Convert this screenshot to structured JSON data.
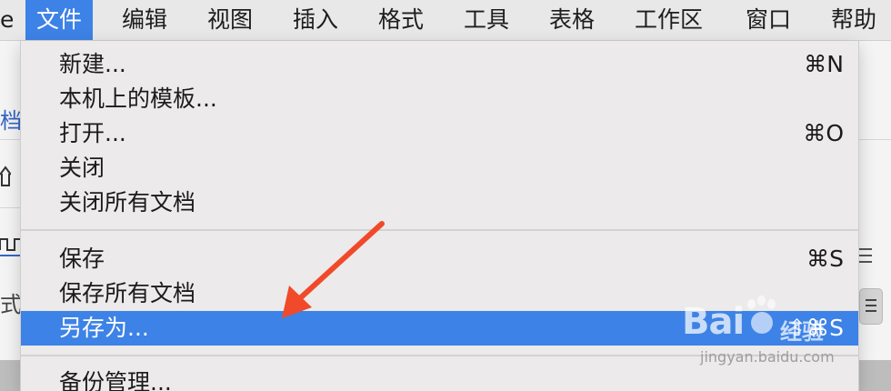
{
  "menubar": {
    "partial_left": "e",
    "items": [
      {
        "label": "文件",
        "active": true
      },
      {
        "label": "编辑"
      },
      {
        "label": "视图"
      },
      {
        "label": "插入"
      },
      {
        "label": "格式"
      },
      {
        "label": "工具"
      },
      {
        "label": "表格"
      },
      {
        "label": "工作区"
      },
      {
        "label": "窗口"
      },
      {
        "label": "帮助"
      }
    ]
  },
  "background": {
    "left_link": "档",
    "left_partial_text": "式",
    "left_home_icon": "home-icon",
    "left_ruler_icon": "ruler-icon"
  },
  "file_menu": {
    "items": [
      {
        "label": "新建...",
        "shortcut": "⌘N"
      },
      {
        "label": "本机上的模板...",
        "shortcut": ""
      },
      {
        "label": "打开...",
        "shortcut": "⌘O"
      },
      {
        "label": "关闭",
        "shortcut": ""
      },
      {
        "label": "关闭所有文档",
        "shortcut": ""
      },
      {
        "label": "保存",
        "shortcut": "⌘S"
      },
      {
        "label": "保存所有文档",
        "shortcut": ""
      },
      {
        "label": "另存为...",
        "shortcut": "⇧⌘S",
        "highlighted": true
      },
      {
        "label": "备份管理...",
        "shortcut": ""
      }
    ]
  },
  "annotation": {
    "arrow_color": "#f04a2a"
  },
  "watermark": {
    "logo": "Bai",
    "logo_cn": "经验",
    "url": "jingyan.baidu.com"
  },
  "colors": {
    "accent": "#3d82e6",
    "menu_bg": "#eceaea",
    "menubar_bg": "#e8e8e8"
  }
}
